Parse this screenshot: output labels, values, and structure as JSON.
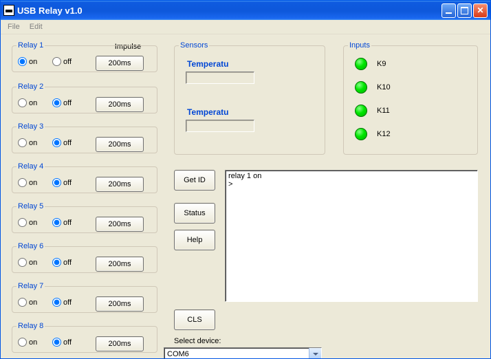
{
  "window": {
    "title": "USB Relay  v1.0"
  },
  "menu": {
    "file": "File",
    "edit": "Edit"
  },
  "labels": {
    "impulse": "Impulse",
    "on": "on",
    "off": "off",
    "select_device": "Select device:"
  },
  "relays": [
    {
      "legend": "Relay 1",
      "selected": "on",
      "impulse": "200ms"
    },
    {
      "legend": "Relay 2",
      "selected": "off",
      "impulse": "200ms"
    },
    {
      "legend": "Relay 3",
      "selected": "off",
      "impulse": "200ms"
    },
    {
      "legend": "Relay 4",
      "selected": "off",
      "impulse": "200ms"
    },
    {
      "legend": "Relay 5",
      "selected": "off",
      "impulse": "200ms"
    },
    {
      "legend": "Relay 6",
      "selected": "off",
      "impulse": "200ms"
    },
    {
      "legend": "Relay 7",
      "selected": "off",
      "impulse": "200ms"
    },
    {
      "legend": "Relay 8",
      "selected": "off",
      "impulse": "200ms"
    }
  ],
  "sensors": {
    "legend": "Sensors",
    "temp1": {
      "label": "Temperatu",
      "value": ""
    },
    "temp2": {
      "label": "Temperatu",
      "value": ""
    }
  },
  "inputs": {
    "legend": "Inputs",
    "items": [
      {
        "label": "K9",
        "state": "on"
      },
      {
        "label": "K10",
        "state": "on"
      },
      {
        "label": "K11",
        "state": "on"
      },
      {
        "label": "K12",
        "state": "on"
      }
    ]
  },
  "buttons": {
    "get_id": "Get ID",
    "status": "Status",
    "help": "Help",
    "cls": "CLS"
  },
  "console_text": "relay 1 on\n>",
  "device": {
    "selected": "COM6"
  }
}
